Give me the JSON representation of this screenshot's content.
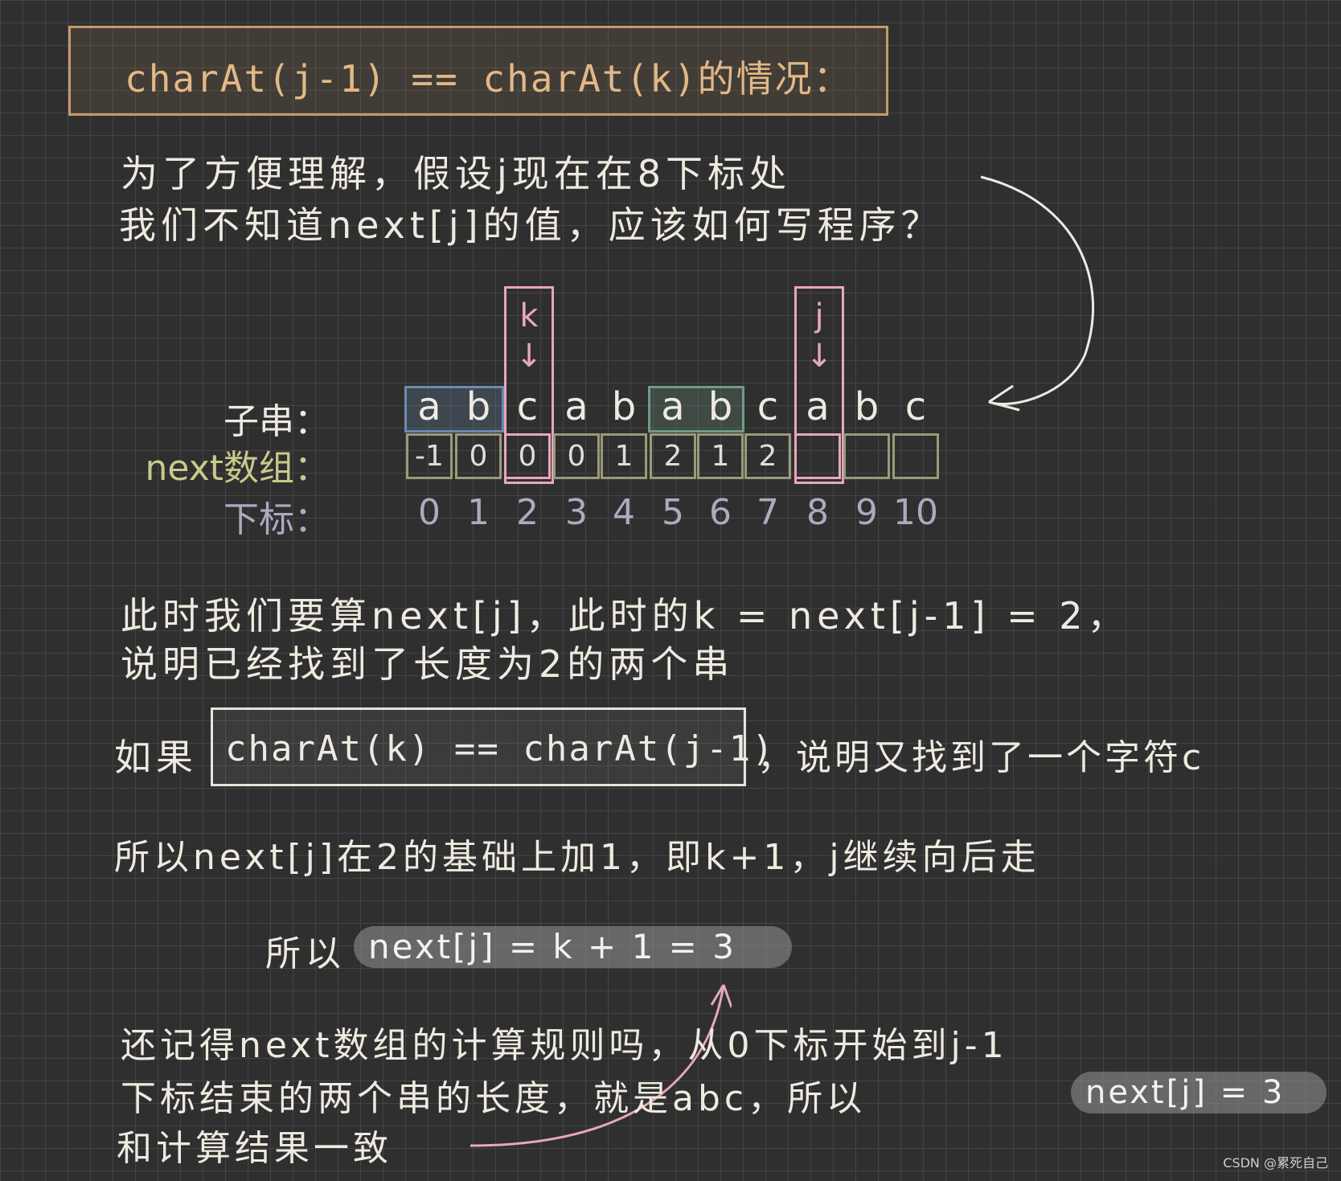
{
  "title": "charAt(j-1) == charAt(k)的情况：",
  "intro": {
    "line1": "为了方便理解，假设j现在在8下标处",
    "line2": "我们不知道next[j]的值，应该如何写程序？"
  },
  "diagram": {
    "string_label": "子串：",
    "next_label": "next数组：",
    "index_label": "下标：",
    "chars": [
      "a",
      "b",
      "c",
      "a",
      "b",
      "a",
      "b",
      "c",
      "a",
      "b",
      "c"
    ],
    "next_values": [
      "-1",
      "0",
      "0",
      "0",
      "1",
      "2",
      "1",
      "2",
      "",
      "",
      ""
    ],
    "indices": [
      "0",
      "1",
      "2",
      "3",
      "4",
      "5",
      "6",
      "7",
      "8",
      "9",
      "10"
    ],
    "k_marker": "k",
    "j_marker": "j",
    "arrow_glyph": "↓"
  },
  "explain": {
    "line1": "此时我们要算next[j]，此时的k = next[j-1] = 2，",
    "line2": "说明已经找到了长度为2的两个串"
  },
  "condition": {
    "prefix": "如果",
    "code": "charAt(k) == charAt(j-1)",
    "suffix": "，说明又找到了一个字符c"
  },
  "so_line": "所以next[j]在2的基础上加1，即k+1，j继续向后走",
  "result": {
    "prefix": "所以",
    "formula": "next[j] = k + 1 = 3"
  },
  "recall": {
    "line1": "还记得next数组的计算规则吗，从0下标开始到j-1",
    "line2": "下标结束的两个串的长度，就是abc，所以",
    "line2_pill": "next[j] = 3",
    "line3": "和计算结果一致"
  },
  "watermark": "CSDN @累死自己",
  "colors": {
    "title": "#e2b886",
    "blue_box": "#6b8ab0",
    "green_box": "#6f9c84",
    "pink": "#e8a7bb",
    "next_label": "#c9c98c",
    "index": "#a9acc0"
  }
}
